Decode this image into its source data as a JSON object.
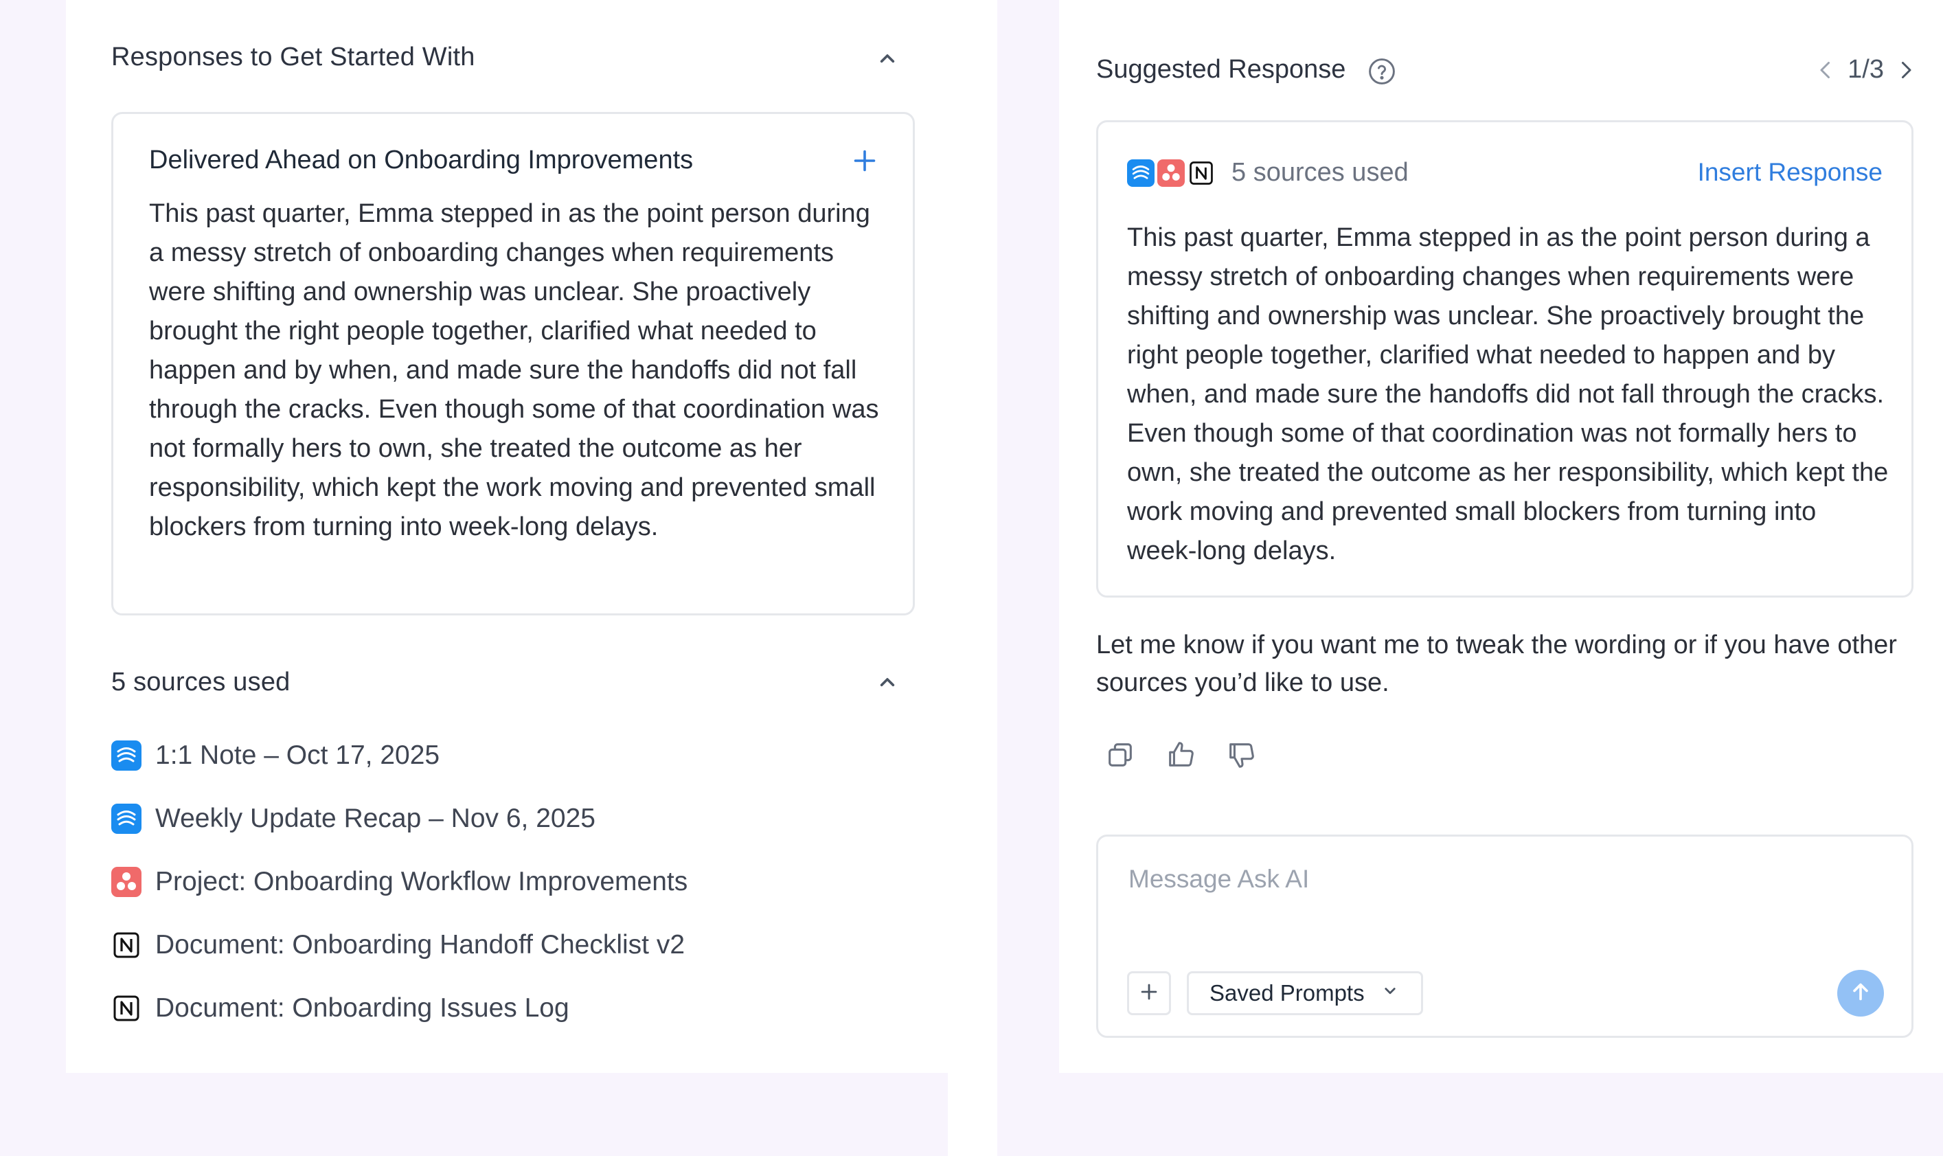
{
  "left": {
    "starters_heading": "Responses to Get Started With",
    "starter_card": {
      "title": "Delivered Ahead on Onboarding Improvements",
      "body": "This past quarter, Emma stepped in as the point person during a messy stretch of onboarding changes when requirements were shifting and ownership was unclear. She proactively brought the right people together, clarified what needed to happen and by when, and made sure the handoffs did not fall through the cracks. Even though some of that coordination was not formally hers to own, she treated the outcome as her responsibility, which kept the work moving and prevented small blockers from turning into week-long delays."
    },
    "sources_heading": "5 sources used",
    "sources": [
      {
        "label": "1:1 Note – Oct 17, 2025",
        "icon": "lattice-icon"
      },
      {
        "label": "Weekly Update Recap – Nov 6, 2025",
        "icon": "lattice-icon"
      },
      {
        "label": "Project: Onboarding Workflow Improvements",
        "icon": "asana-icon"
      },
      {
        "label": "Document: Onboarding Handoff Checklist v2",
        "icon": "notion-icon"
      },
      {
        "label": "Document: Onboarding Issues Log",
        "icon": "notion-icon"
      }
    ]
  },
  "right": {
    "title": "Suggested Response",
    "pager": "1/3",
    "card": {
      "sources_count": "5 sources used",
      "insert_label": "Insert Response",
      "body": "This past quarter, Emma stepped in as the point person during a messy stretch of onboarding changes when requirements were shifting and ownership was unclear. She proactively brought the right people together, clarified what needed to happen and by when, and made sure the handoffs did not fall through the cracks. Even though some of that coordination was not formally hers to own, she treated the outcome as her responsibility, which kept the work moving and prevented small blockers from turning into week-long delays."
    },
    "followup": "Let me know if you want me to tweak the wording or if you have other sources you’d like to use.",
    "composer": {
      "placeholder": "Message Ask AI",
      "saved_prompts_label": "Saved Prompts"
    }
  },
  "colors": {
    "accent": "#2f7dde",
    "background": "#f8f4fd",
    "lattice": "#1a8cf0",
    "asana": "#f06a6a",
    "send": "#93c1f5"
  }
}
